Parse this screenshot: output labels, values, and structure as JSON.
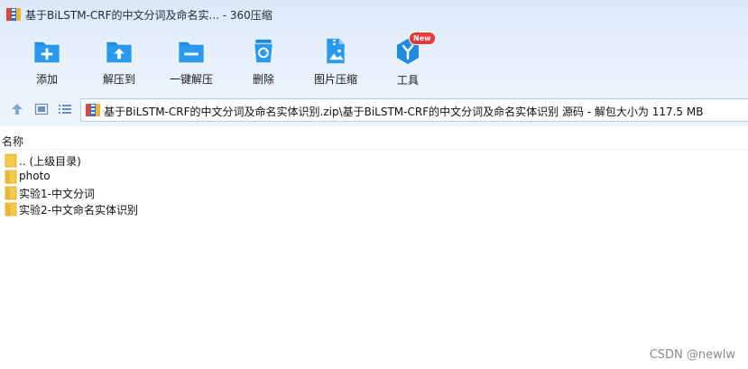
{
  "window": {
    "title": "基于BiLSTM-CRF的中文分词及命名实... - 360压缩"
  },
  "toolbar": {
    "items": [
      {
        "label": "添加",
        "icon": "add-folder-icon"
      },
      {
        "label": "解压到",
        "icon": "extract-to-icon"
      },
      {
        "label": "一键解压",
        "icon": "one-click-extract-icon"
      },
      {
        "label": "删除",
        "icon": "recycle-bin-icon"
      },
      {
        "label": "图片压缩",
        "icon": "image-compress-icon"
      },
      {
        "label": "工具",
        "icon": "tools-icon",
        "badge": "New"
      }
    ]
  },
  "navbar": {
    "address": "基于BiLSTM-CRF的中文分词及命名实体识别.zip\\基于BiLSTM-CRF的中文分词及命名实体识别 源码 - 解包大小为 117.5 MB"
  },
  "list": {
    "column_name": "名称",
    "items": [
      {
        "name": ".. (上级目录)",
        "type": "folder"
      },
      {
        "name": "photo",
        "type": "folder"
      },
      {
        "name": "实验1-中文分词",
        "type": "folder"
      },
      {
        "name": "实验2-中文命名实体识别",
        "type": "folder"
      }
    ]
  },
  "watermark": "CSDN @newlw",
  "colors": {
    "accent": "#1e8be0",
    "band": "#dbe9f8",
    "folder": "#f5c94a",
    "badge": "#e83a3a"
  }
}
